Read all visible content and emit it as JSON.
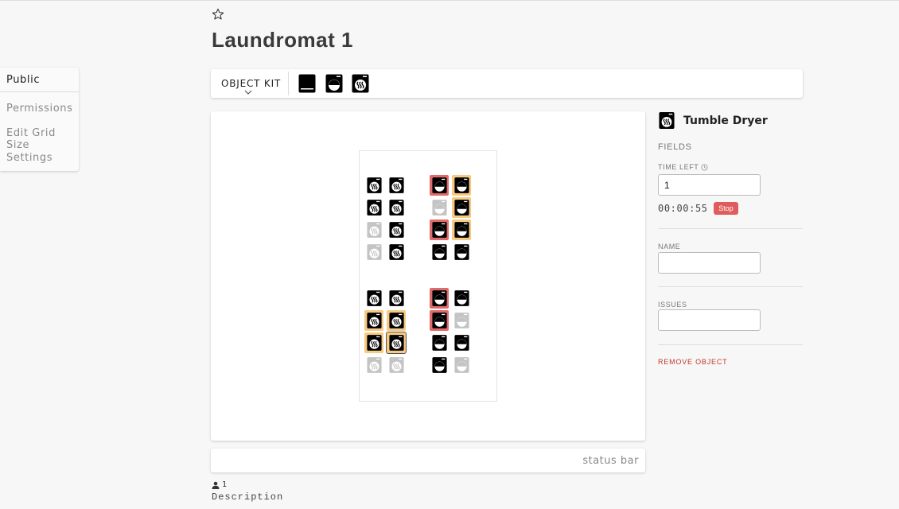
{
  "page": {
    "title": "Laundromat 1"
  },
  "colors": {
    "red": "#e06a6a",
    "orange": "#f7c981",
    "black": "#000000",
    "grey": "#c4c4c4",
    "danger": "#c0392b"
  },
  "side_menu": {
    "items": [
      {
        "label": "Public",
        "active": true
      },
      {
        "label": "Permissions",
        "active": false
      },
      {
        "label": "Edit Grid Size",
        "active": false
      },
      {
        "label": "Settings",
        "active": false
      }
    ]
  },
  "toolbar": {
    "kit_label": "OBJECT KIT",
    "kit_items": [
      "table-icon",
      "washer-icon",
      "dryer-icon"
    ]
  },
  "machines": [
    {
      "type": "dryer",
      "icon": "black",
      "status": "none"
    },
    {
      "type": "dryer",
      "icon": "black",
      "status": "none"
    },
    {
      "type": "washer",
      "icon": "black",
      "status": "red"
    },
    {
      "type": "washer",
      "icon": "black",
      "status": "orange"
    },
    {
      "type": "dryer",
      "icon": "black",
      "status": "none"
    },
    {
      "type": "dryer",
      "icon": "black",
      "status": "none"
    },
    {
      "type": "washer",
      "icon": "grey",
      "status": "none"
    },
    {
      "type": "washer",
      "icon": "black",
      "status": "orange"
    },
    {
      "type": "dryer",
      "icon": "grey",
      "status": "none"
    },
    {
      "type": "dryer",
      "icon": "black",
      "status": "none"
    },
    {
      "type": "washer",
      "icon": "black",
      "status": "red"
    },
    {
      "type": "washer",
      "icon": "black",
      "status": "orange"
    },
    {
      "type": "dryer",
      "icon": "grey",
      "status": "none"
    },
    {
      "type": "dryer",
      "icon": "black",
      "status": "none"
    },
    {
      "type": "washer",
      "icon": "black",
      "status": "none"
    },
    {
      "type": "washer",
      "icon": "black",
      "status": "none"
    },
    {
      "type": "dryer",
      "icon": "black",
      "status": "none"
    },
    {
      "type": "dryer",
      "icon": "black",
      "status": "none"
    },
    {
      "type": "washer",
      "icon": "black",
      "status": "red"
    },
    {
      "type": "washer",
      "icon": "black",
      "status": "none"
    },
    {
      "type": "dryer",
      "icon": "black",
      "status": "orange"
    },
    {
      "type": "dryer",
      "icon": "black",
      "status": "orange"
    },
    {
      "type": "washer",
      "icon": "black",
      "status": "red"
    },
    {
      "type": "washer",
      "icon": "grey",
      "status": "none"
    },
    {
      "type": "dryer",
      "icon": "black",
      "status": "orange"
    },
    {
      "type": "dryer",
      "icon": "black",
      "status": "orange",
      "selected": true
    },
    {
      "type": "washer",
      "icon": "black",
      "status": "none"
    },
    {
      "type": "washer",
      "icon": "black",
      "status": "none"
    },
    {
      "type": "dryer",
      "icon": "grey",
      "status": "none"
    },
    {
      "type": "dryer",
      "icon": "grey",
      "status": "none"
    },
    {
      "type": "washer",
      "icon": "black",
      "status": "none"
    },
    {
      "type": "washer",
      "icon": "grey",
      "status": "none"
    }
  ],
  "status_bar": {
    "text": "status bar"
  },
  "footer": {
    "user_count": "1",
    "description": "Description"
  },
  "panel": {
    "object_title": "Tumble Dryer",
    "fields_label": "FIELDS",
    "time_left_label": "TIME LEFT",
    "time_left_value": "1",
    "timer": "00:00:55",
    "stop_label": "Stop",
    "name_label": "NAME",
    "name_value": "",
    "issues_label": "ISSUES",
    "issues_value": "",
    "remove_label": "REMOVE OBJECT"
  }
}
